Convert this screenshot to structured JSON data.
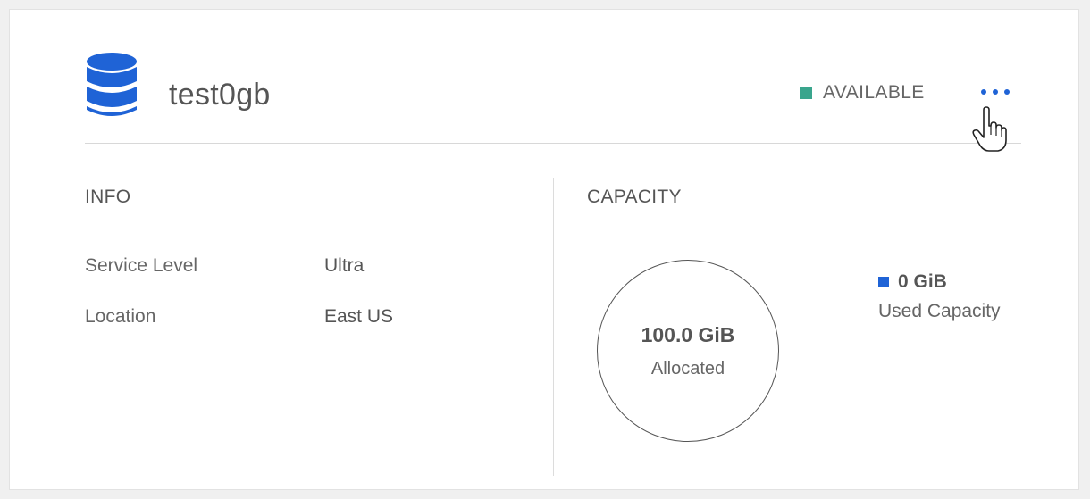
{
  "volume": {
    "name": "test0gb",
    "icon": "database-icon",
    "status": "AVAILABLE",
    "status_color": "#3aa58d",
    "more_icon": "more-horizontal-icon"
  },
  "info": {
    "title": "INFO",
    "rows": [
      {
        "label": "Service Level",
        "value": "Ultra"
      },
      {
        "label": "Location",
        "value": "East US"
      }
    ]
  },
  "capacity": {
    "title": "CAPACITY",
    "allocated_value": "100.0 GiB",
    "allocated_label": "Allocated",
    "used_value": "0 GiB",
    "used_label": "Used Capacity",
    "used_color": "#1f63d6"
  },
  "colors": {
    "accent_blue": "#1f63d6"
  }
}
